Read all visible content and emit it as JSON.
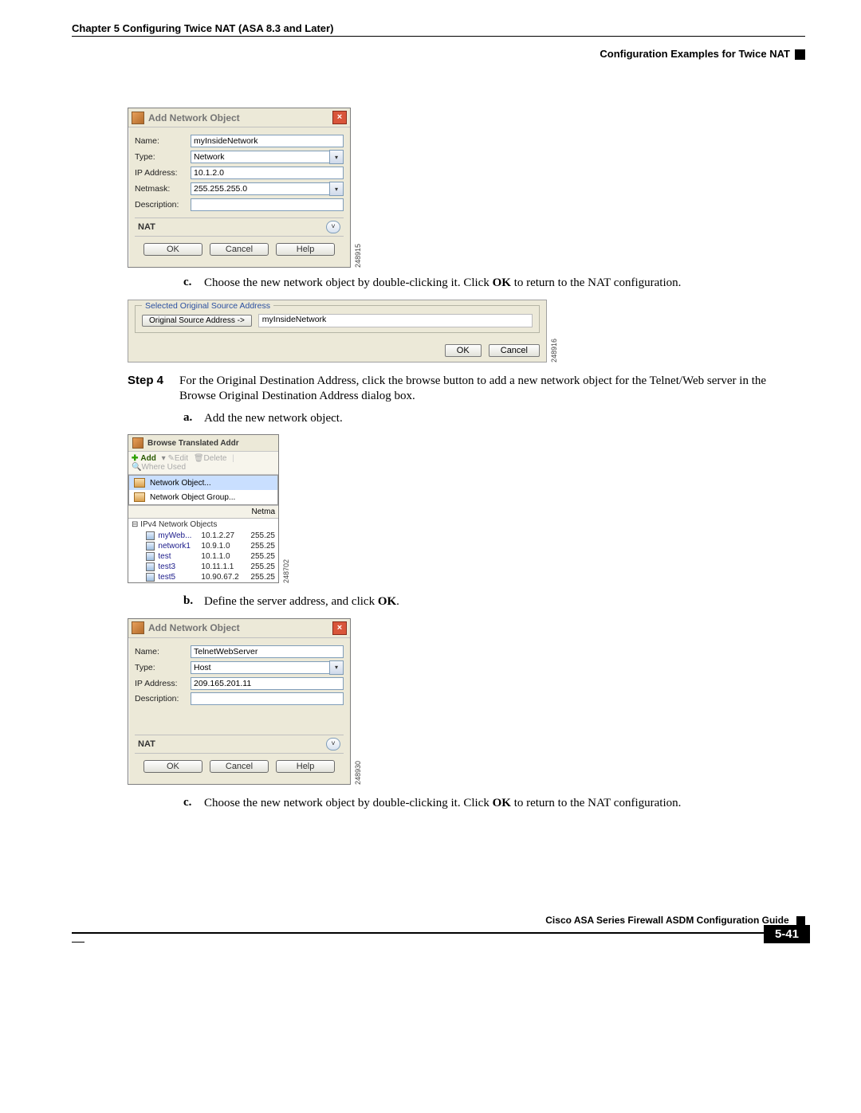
{
  "header": {
    "chapter": "Chapter 5    Configuring Twice NAT (ASA 8.3 and Later)",
    "section": "Configuration Examples for Twice NAT"
  },
  "dialog1": {
    "title": "Add Network Object",
    "name_lbl": "Name:",
    "name_val": "myInsideNetwork",
    "type_lbl": "Type:",
    "type_val": "Network",
    "ip_lbl": "IP Address:",
    "ip_val": "10.1.2.0",
    "mask_lbl": "Netmask:",
    "mask_val": "255.255.255.0",
    "desc_lbl": "Description:",
    "desc_val": "",
    "nat": "NAT",
    "ok": "OK",
    "cancel": "Cancel",
    "help": "Help",
    "figno": "248915"
  },
  "step_c1": {
    "tag": "c.",
    "pre": "Choose the new network object by double-clicking it. Click ",
    "bold": "OK",
    "post": " to return to the NAT configuration."
  },
  "selbox": {
    "legend": "Selected Original Source Address",
    "btn": "Original Source Address ->",
    "val": "myInsideNetwork",
    "ok": "OK",
    "cancel": "Cancel",
    "figno": "248916"
  },
  "step4": {
    "label": "Step 4",
    "text1": "For the Original Destination Address, click the browse button to add a new network object for the Telnet/Web server in the Browse Original Destination Address dialog box.",
    "a_tag": "a.",
    "a_text": "Add the new network object."
  },
  "browse": {
    "title": "Browse Translated Addr",
    "add": "Add",
    "edit": "Edit",
    "del": "Delete",
    "where": "Where Used",
    "m1": "Network Object...",
    "m2": "Network Object Group...",
    "hdr_netma": "Netma",
    "cat": "IPv4 Network Objects",
    "rows": [
      {
        "nm": "myWeb...",
        "ip": "10.1.2.27",
        "mk": "255.25"
      },
      {
        "nm": "network1",
        "ip": "10.9.1.0",
        "mk": "255.25"
      },
      {
        "nm": "test",
        "ip": "10.1.1.0",
        "mk": "255.25"
      },
      {
        "nm": "test3",
        "ip": "10.11.1.1",
        "mk": "255.25"
      },
      {
        "nm": "test5",
        "ip": "10.90.67.2",
        "mk": "255.25"
      }
    ],
    "figno": "248702"
  },
  "step_b": {
    "tag": "b.",
    "pre": "Define the server address, and click ",
    "bold": "OK",
    "post": "."
  },
  "dialog2": {
    "title": "Add Network Object",
    "name_lbl": "Name:",
    "name_val": "TelnetWebServer",
    "type_lbl": "Type:",
    "type_val": "Host",
    "ip_lbl": "IP Address:",
    "ip_val": "209.165.201.11",
    "desc_lbl": "Description:",
    "desc_val": "",
    "nat": "NAT",
    "ok": "OK",
    "cancel": "Cancel",
    "help": "Help",
    "figno": "248930"
  },
  "step_c2": {
    "tag": "c.",
    "pre": "Choose the new network object by double-clicking it. Click ",
    "bold": "OK",
    "post": " to return to the NAT configuration."
  },
  "footer": {
    "guide": "Cisco ASA Series Firewall ASDM Configuration Guide",
    "page": "5-41"
  }
}
